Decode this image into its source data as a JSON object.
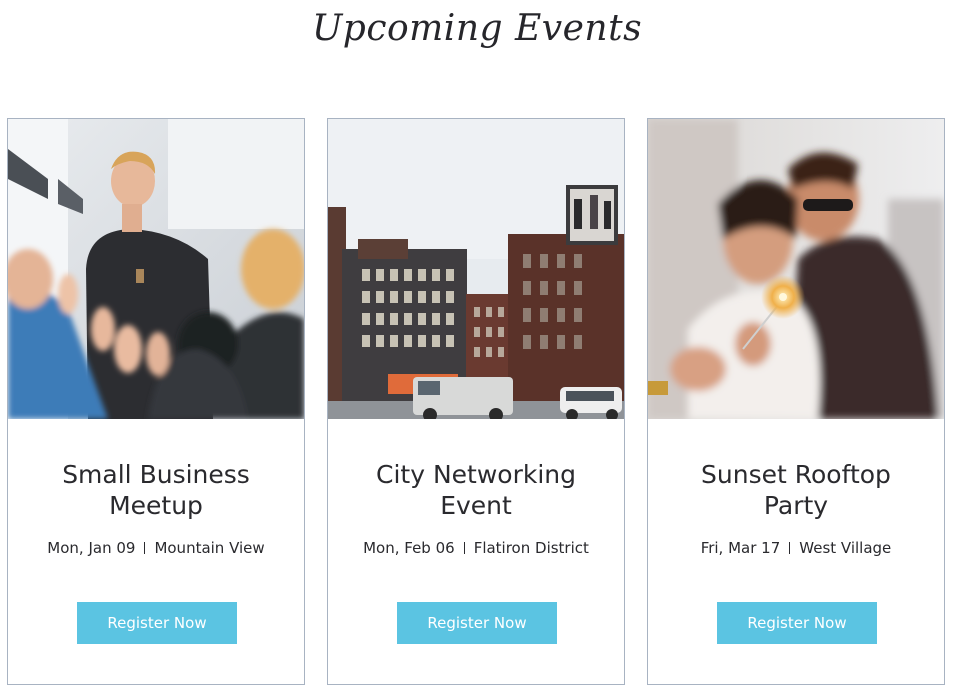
{
  "page": {
    "title": "Upcoming Events"
  },
  "events": [
    {
      "title_line1": "Small Business",
      "title_line2": "Meetup",
      "date": "Mon, Jan 09",
      "location": "Mountain View",
      "button_label": "Register Now"
    },
    {
      "title_line1": "City Networking",
      "title_line2": "Event",
      "date": "Mon, Feb 06",
      "location": "Flatiron District",
      "button_label": "Register Now"
    },
    {
      "title_line1": "Sunset Rooftop",
      "title_line2": "Party",
      "date": "Fri, Mar 17",
      "location": "West Village",
      "button_label": "Register Now"
    }
  ],
  "colors": {
    "button": "#5bc4e2",
    "card_border": "#a8b3c2"
  }
}
